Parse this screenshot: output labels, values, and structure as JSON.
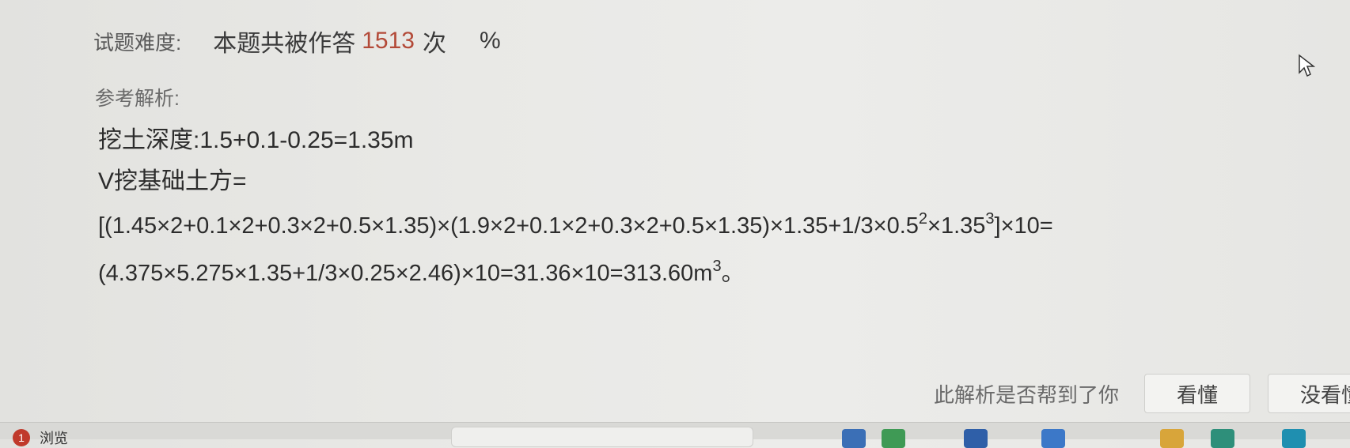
{
  "difficulty": {
    "label": "试题难度:",
    "answered_text": "本题共被作答",
    "answered_count": "1513",
    "answered_unit": "次",
    "percent": "%"
  },
  "analysis": {
    "label": "参考解析:",
    "lines": [
      "挖土深度:1.5+0.1-0.25=1.35m",
      "V挖基础土方="
    ],
    "formula1": {
      "part_a": "[(1.45×2+0.1×2+0.3×2+0.5×1.35)×(1.9×2+0.1×2+0.3×2+0.5×1.35)×1.35+1/3×0.5",
      "exp_a": "2",
      "part_b": "×1.35",
      "exp_b": "3",
      "part_c": "]×10="
    },
    "formula2": {
      "part_a": "(4.375×5.275×1.35+1/3×0.25×2.46)×10=31.36×10=313.60m",
      "exp_a": "3",
      "part_b": "。"
    }
  },
  "feedback": {
    "question": "此解析是否帮到了你",
    "understood_label": "看懂",
    "not_understood_label": "没看懂"
  },
  "taskbar": {
    "badge_count": "1",
    "label": "浏览"
  },
  "icons": [
    "cursor-arrow-icon",
    "taskbar-app-icon"
  ],
  "colors": {
    "count_highlight": "#b34a38",
    "badge": "#c0392b"
  }
}
